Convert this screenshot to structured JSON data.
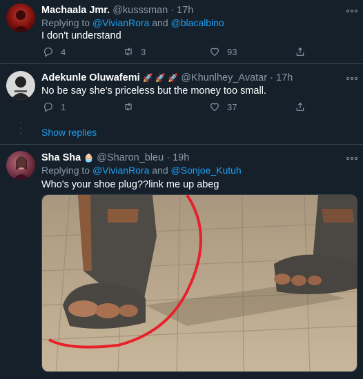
{
  "tweets": [
    {
      "name": "Machaala Jmr.",
      "handle": "@kusssman",
      "sep": "·",
      "time": "17h",
      "replying_prefix": "Replying to ",
      "replying_a": "@VivianRora",
      "replying_and": " and ",
      "replying_b": "@blacalbino",
      "text": "I don't understand",
      "replies": "4",
      "retweets": "3",
      "likes": "93"
    },
    {
      "name": "Adekunle Oluwafemi",
      "name_emoji": "🚀 🚀 🚀",
      "handle": "@Khunlhey_Avatar",
      "sep": "·",
      "time": "17h",
      "text": "No be say she's priceless but the money too small.",
      "replies": "1",
      "retweets": "",
      "likes": "37"
    },
    {
      "name": "Sha Sha",
      "name_emoji": "🧁",
      "handle": "@Sharon_bleu",
      "sep": "·",
      "time": "19h",
      "replying_prefix": "Replying to ",
      "replying_a": "@VivianRora",
      "replying_and": " and ",
      "replying_b": "@Sonjoe_Kutuh",
      "text": "Who's your shoe plug??link me up abeg"
    }
  ],
  "show_replies": "Show replies",
  "more_glyph": "∘∘∘",
  "icons": [
    "reply-icon",
    "retweet-icon",
    "like-icon",
    "share-icon",
    "more-icon"
  ],
  "colors": {
    "background": "#15202b",
    "accent": "#1da1f2",
    "muted": "#8899a6",
    "divider": "#38444d"
  }
}
